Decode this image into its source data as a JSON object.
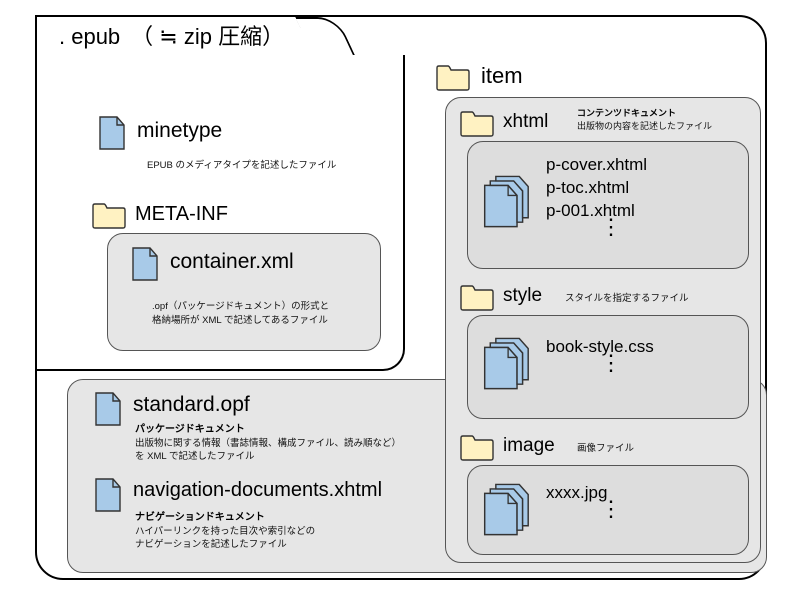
{
  "title": ". epub　（ ≒ zip 圧縮）",
  "minetype": {
    "label": "minetype",
    "desc": "EPUB のメディアタイプを記述したファイル"
  },
  "metainf": {
    "label": "META-INF",
    "file": "container.xml",
    "desc1": ".opf（パッケージドキュメント）の形式と",
    "desc2": "格納場所が XML で記述してあるファイル"
  },
  "standard": {
    "label": "standard.opf",
    "sub": "パッケージドキュメント",
    "desc1": "出版物に関する情報（書誌情報、構成ファイル、読み順など）",
    "desc2": "を XML で記述したファイル"
  },
  "nav": {
    "label": "navigation-documents.xhtml",
    "sub": "ナビゲーションドキュメント",
    "desc1": "ハイパーリンクを持った目次や索引などの",
    "desc2": "ナビゲーションを記述したファイル"
  },
  "item": {
    "label": "item"
  },
  "xhtml": {
    "label": "xhtml",
    "sub": "コンテンツドキュメント",
    "desc": "出版物の内容を記述したファイル",
    "files": [
      "p-cover.xhtml",
      "p-toc.xhtml",
      "p-001.xhtml"
    ]
  },
  "style": {
    "label": "style",
    "desc": "スタイルを指定するファイル",
    "file": "book-style.css"
  },
  "image": {
    "label": "image",
    "desc": "画像ファイル",
    "file": "xxxx.jpg"
  },
  "dots": "⋮"
}
